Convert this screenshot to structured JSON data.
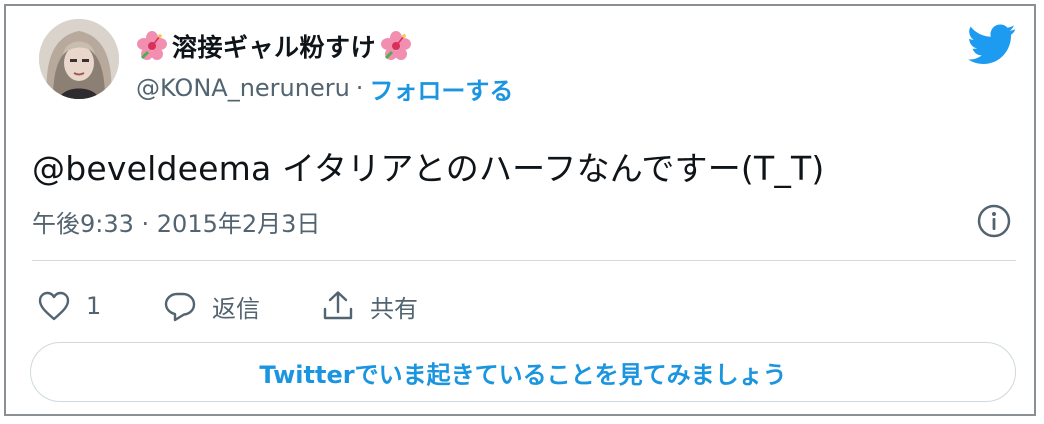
{
  "user": {
    "display_name": "溶接ギャル粉すけ",
    "handle": "@KONA_neruneru",
    "separator": "·",
    "follow_label": "フォローする",
    "name_emoji": "hibiscus-icon"
  },
  "tweet": {
    "text": "@beveldeema イタリアとのハーフなんですー(T_T)",
    "timestamp": "午後9:33 · 2015年2月3日"
  },
  "actions": {
    "like_count": "1",
    "reply_label": "返信",
    "share_label": "共有"
  },
  "cta": {
    "label": "Twitterでいま起きていることを見てみましょう"
  },
  "colors": {
    "twitter_blue": "#1b95e0",
    "text_primary": "#0f1419",
    "text_secondary": "#536471",
    "border": "#cfd9de",
    "hibiscus": "#f28fb0"
  }
}
